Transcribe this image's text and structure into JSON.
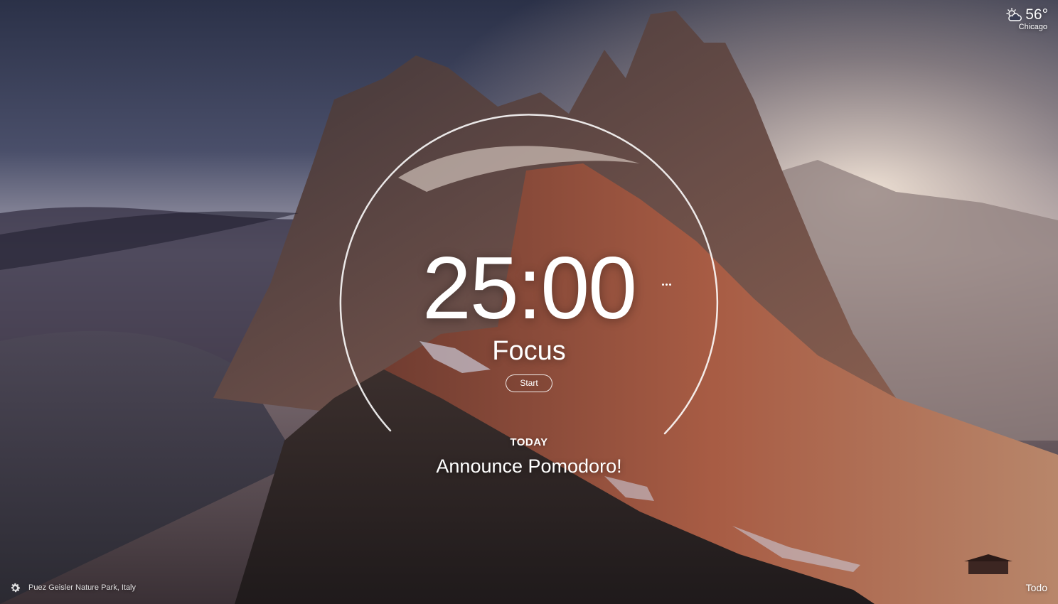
{
  "weather": {
    "icon": "partly-cloudy-sun-icon",
    "temperature": "56°",
    "city": "Chicago"
  },
  "pomodoro": {
    "time": "25:00",
    "mode": "Focus",
    "start_label": "Start",
    "more_icon": "ellipsis-icon"
  },
  "today": {
    "label": "TODAY",
    "task": "Announce Pomodoro!"
  },
  "footer": {
    "settings_icon": "gear-icon",
    "location": "Puez Geisler Nature Park, Italy",
    "todo_label": "Todo"
  }
}
